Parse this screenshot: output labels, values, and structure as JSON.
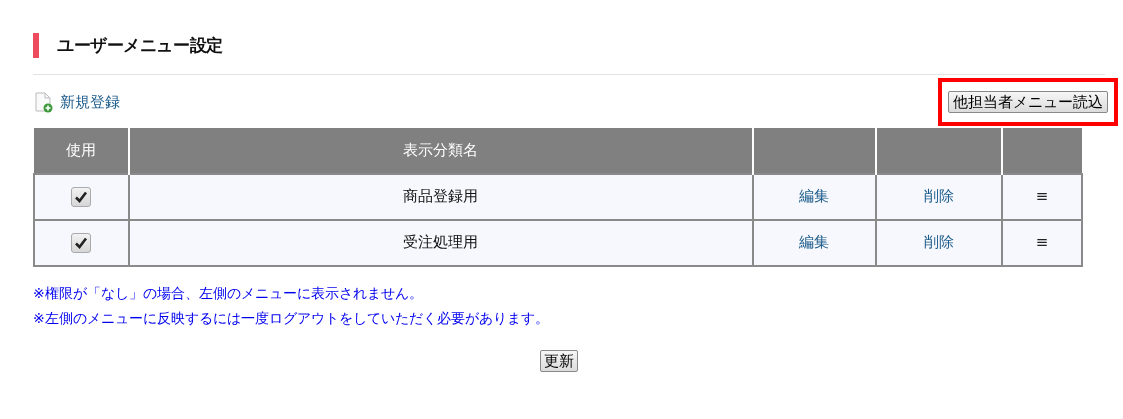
{
  "title": "ユーザーメニュー設定",
  "new_link": "新規登録",
  "load_button": {
    "label": "他担当者メニュー読込",
    "highlighted": true
  },
  "table": {
    "columns": [
      "使用",
      "表示分類名"
    ],
    "rows": [
      {
        "checked": true,
        "name": "商品登録用",
        "edit": "編集",
        "delete": "削除",
        "handle": "≡"
      },
      {
        "checked": true,
        "name": "受注処理用",
        "edit": "編集",
        "delete": "削除",
        "handle": "≡"
      }
    ]
  },
  "notes": [
    "※権限が「なし」の場合、左側のメニューに表示されません。",
    "※左側のメニューに反映するには一度ログアウトをしていただく必要があります。"
  ],
  "update_button": "更新"
}
